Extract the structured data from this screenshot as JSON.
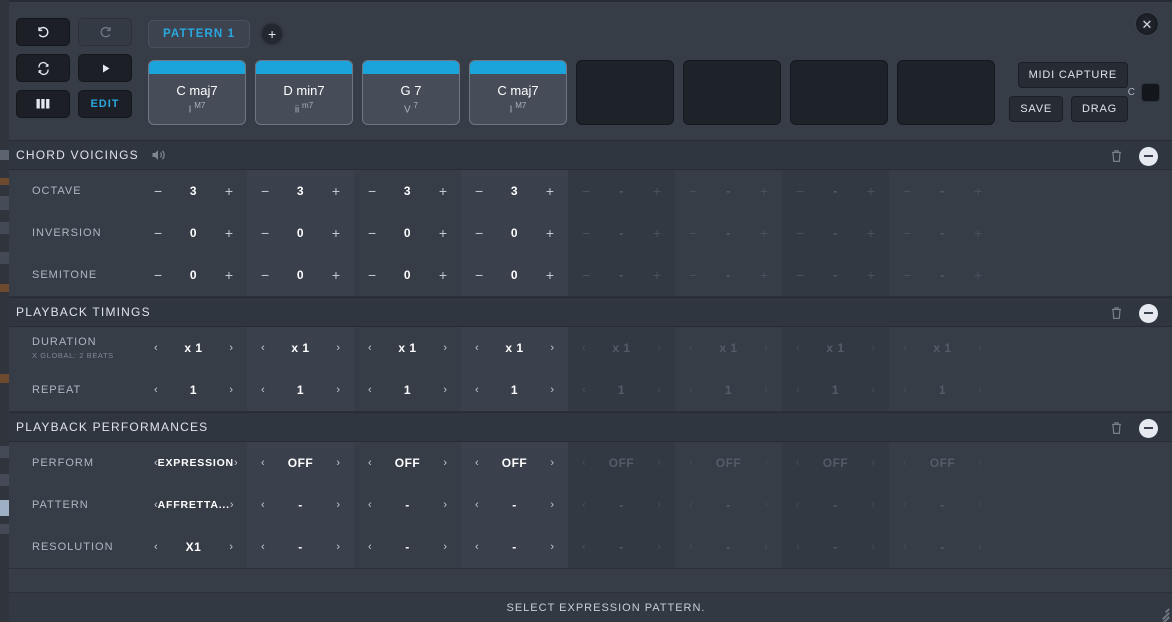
{
  "window": {
    "close_label": "✕"
  },
  "toolbar": {
    "undo": "undo-arrow",
    "redo": "redo-arrow",
    "loop": "loop-arrows",
    "play": "play-triangle",
    "keyboard": "keyboard-grid",
    "edit_label": "EDIT"
  },
  "patterns": {
    "tabs": [
      {
        "label": "PATTERN 1",
        "active": true
      }
    ],
    "add_label": "+"
  },
  "slots": [
    {
      "name": "C maj7",
      "degree": "I",
      "quality": "M7",
      "filled": true
    },
    {
      "name": "D min7",
      "degree": "ii",
      "quality": "m7",
      "filled": true
    },
    {
      "name": "G 7",
      "degree": "V",
      "quality": "7",
      "filled": true
    },
    {
      "name": "C maj7",
      "degree": "I",
      "quality": "M7",
      "filled": true
    },
    {
      "name": "",
      "degree": "",
      "quality": "",
      "filled": false
    },
    {
      "name": "",
      "degree": "",
      "quality": "",
      "filled": false
    },
    {
      "name": "",
      "degree": "",
      "quality": "",
      "filled": false
    },
    {
      "name": "",
      "degree": "",
      "quality": "",
      "filled": false
    }
  ],
  "right_controls": {
    "midi_capture": "MIDI CAPTURE",
    "save": "SAVE",
    "drag": "DRAG",
    "c_label": "C"
  },
  "sections": [
    {
      "title": "CHORD VOICINGS",
      "has_speaker": true,
      "rows": [
        {
          "label": "OCTAVE",
          "sub": "",
          "type": "stepper",
          "values": [
            "3",
            "3",
            "3",
            "3",
            "-",
            "-",
            "-",
            "-"
          ]
        },
        {
          "label": "INVERSION",
          "sub": "",
          "type": "stepper",
          "values": [
            "0",
            "0",
            "0",
            "0",
            "-",
            "-",
            "-",
            "-"
          ]
        },
        {
          "label": "SEMITONE",
          "sub": "",
          "type": "stepper",
          "values": [
            "0",
            "0",
            "0",
            "0",
            "-",
            "-",
            "-",
            "-"
          ]
        }
      ]
    },
    {
      "title": "PLAYBACK TIMINGS",
      "has_speaker": false,
      "rows": [
        {
          "label": "DURATION",
          "sub": "X GLOBAL: 2 BEATS",
          "type": "arrows",
          "values": [
            "x 1",
            "x 1",
            "x 1",
            "x 1",
            "x 1",
            "x 1",
            "x 1",
            "x 1"
          ]
        },
        {
          "label": "REPEAT",
          "sub": "",
          "type": "arrows",
          "values": [
            "1",
            "1",
            "1",
            "1",
            "1",
            "1",
            "1",
            "1"
          ]
        }
      ]
    },
    {
      "title": "PLAYBACK PERFORMANCES",
      "has_speaker": false,
      "rows": [
        {
          "label": "PERFORM",
          "sub": "",
          "type": "arrows",
          "values": [
            "EXPRESSION",
            "OFF",
            "OFF",
            "OFF",
            "OFF",
            "OFF",
            "OFF",
            "OFF"
          ]
        },
        {
          "label": "PATTERN",
          "sub": "",
          "type": "arrows",
          "values": [
            "AFFRETTA...",
            "-",
            "-",
            "-",
            "-",
            "-",
            "-",
            "-"
          ]
        },
        {
          "label": "RESOLUTION",
          "sub": "",
          "type": "arrows",
          "values": [
            "X1",
            "-",
            "-",
            "-",
            "-",
            "-",
            "-",
            "-"
          ]
        }
      ]
    }
  ],
  "section_icons": {
    "trash": "trash-icon",
    "collapse": "collapse-icon"
  },
  "status": {
    "message": "SELECT EXPRESSION PATTERN."
  },
  "colors": {
    "accent": "#1ba4dc",
    "panel": "#373d47",
    "header": "#30363f"
  },
  "filled_slot_count": 4
}
